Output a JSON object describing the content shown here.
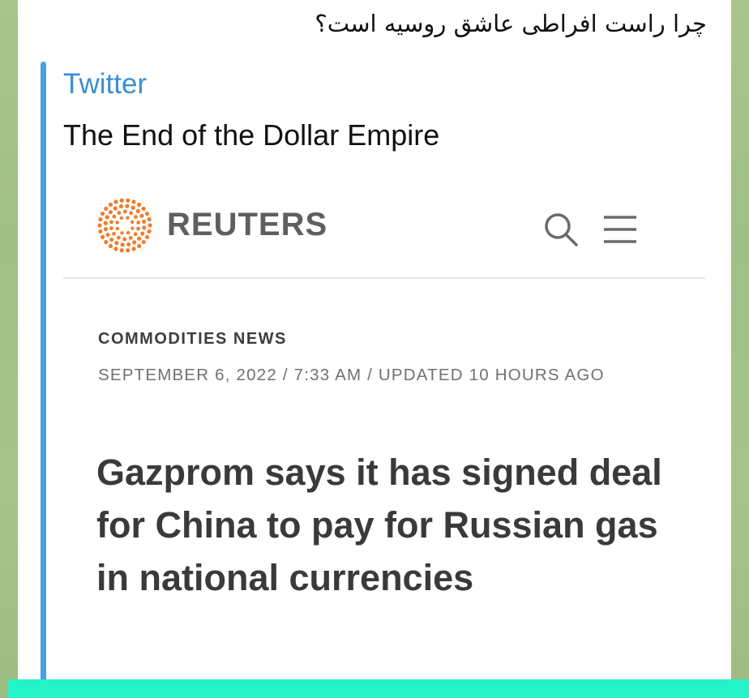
{
  "message": {
    "text": "چرا راست افراطی عاشق روسیه است؟"
  },
  "link_preview": {
    "site_name": "Twitter",
    "title": "The End of the Dollar Empire",
    "accent_color": "#4a9fde"
  },
  "article": {
    "brand": "REUTERS",
    "brand_logo_color": "#f07d2c",
    "header_icons": [
      "search-icon",
      "menu-icon"
    ],
    "section": "COMMODITIES NEWS",
    "dateline": "SEPTEMBER 6, 2022 / 7:33 AM / UPDATED 10 HOURS AGO",
    "headline": "Gazprom says it has signed deal for China to pay for Russian gas in national currencies"
  },
  "colors": {
    "bottom_strip": "#26f2c8",
    "link_color": "#3b8fd0"
  }
}
